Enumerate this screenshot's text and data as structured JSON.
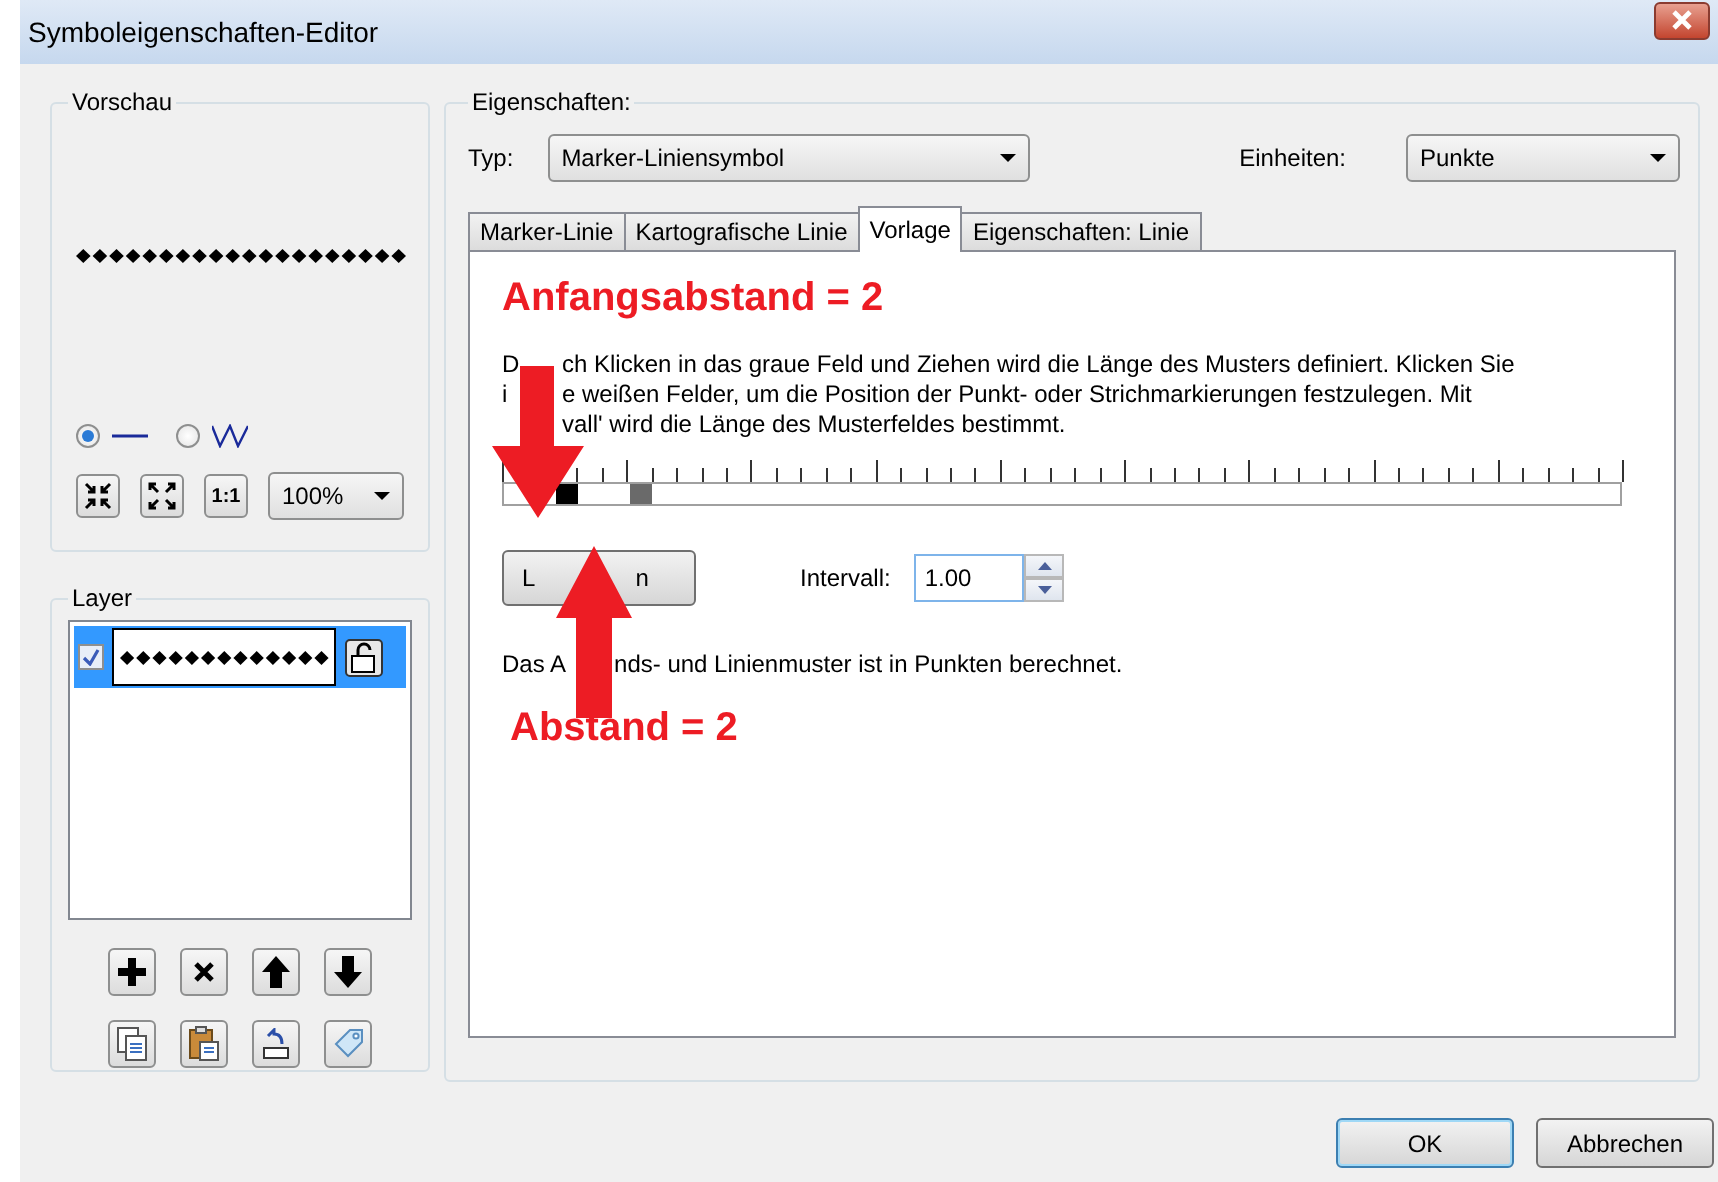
{
  "window": {
    "title": "Symboleigenschaften-Editor"
  },
  "preview": {
    "title": "Vorschau",
    "line_modes": [
      {
        "kind": "straight",
        "selected": true
      },
      {
        "kind": "zigzag",
        "selected": false
      }
    ],
    "scale_button": "1:1",
    "zoom": "100%"
  },
  "layers": {
    "title": "Layer",
    "items": [
      {
        "checked": true,
        "selected": true
      }
    ]
  },
  "properties": {
    "title": "Eigenschaften:",
    "type_label": "Typ:",
    "type_value": "Marker-Liniensymbol",
    "units_label": "Einheiten:",
    "units_value": "Punkte",
    "tabs": [
      {
        "label": "Marker-Linie",
        "selected": false
      },
      {
        "label": "Kartografische Linie",
        "selected": false
      },
      {
        "label": "Vorlage",
        "selected": true
      },
      {
        "label": "Eigenschaften: Linie",
        "selected": false
      }
    ],
    "start_annotation": "Anfangsabstand = 2",
    "instructions": [
      {
        "lead": "D",
        "rest": "ch Klicken in das graue Feld und Ziehen wird die Länge des Musters definiert. Klicken Sie"
      },
      {
        "lead": "i",
        "rest": "e weißen Felder, um die Position der Punkt- oder Strichmarkierungen festzulegen. Mit"
      },
      {
        "rest": "vall' wird die Länge des Musterfeldes bestimmt."
      }
    ],
    "pattern_cells": [
      {
        "kind": "blank"
      },
      {
        "kind": "blank"
      },
      {
        "kind": "mark"
      },
      {
        "kind": "blank"
      },
      {
        "kind": "blank"
      },
      {
        "kind": "end"
      }
    ],
    "delete_button": [
      "L",
      "n"
    ],
    "interval_label": "Intervall:",
    "interval_value": "1.00",
    "note": {
      "lead": "Das A",
      "rest": "nds- und Linienmuster ist in Punkten berechnet."
    },
    "gap_annotation": "Abstand = 2"
  },
  "buttons": [
    {
      "label": "OK",
      "default": true
    },
    {
      "label": "Abbrechen",
      "default": false
    }
  ]
}
